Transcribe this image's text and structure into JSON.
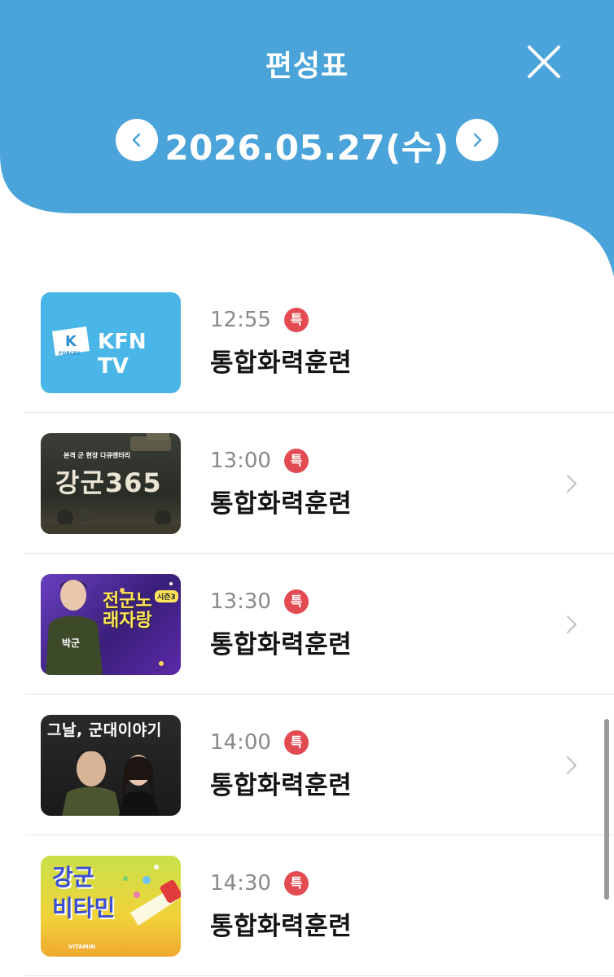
{
  "header": {
    "title": "편성표",
    "date": "2026.05.27(수)",
    "colors": {
      "header_bg": "#4aa3d9",
      "badge": "#e34b52"
    }
  },
  "icons": {
    "close": "close-icon",
    "prev": "chevron-left-icon",
    "next": "chevron-right-icon"
  },
  "schedule": [
    {
      "time": "12:55",
      "badge": "특",
      "title": "통합화력훈련",
      "thumb_title": "KFN TV",
      "thumb_sub": "FORCES"
    },
    {
      "time": "13:00",
      "badge": "특",
      "title": "통합화력훈련",
      "thumb_title": "강군365",
      "thumb_sub": "본격 군 현장 다큐멘터리"
    },
    {
      "time": "13:30",
      "badge": "특",
      "title": "통합화력훈련",
      "thumb_title": "전군노래자랑",
      "thumb_sub": "시즌3",
      "thumb_name": "박군"
    },
    {
      "time": "14:00",
      "badge": "특",
      "title": "통합화력훈련",
      "thumb_title": "그날, 군대이야기"
    },
    {
      "time": "14:30",
      "badge": "특",
      "title": "통합화력훈련",
      "thumb_title": "강군 비타민",
      "thumb_sub": "VITAMIN"
    }
  ]
}
